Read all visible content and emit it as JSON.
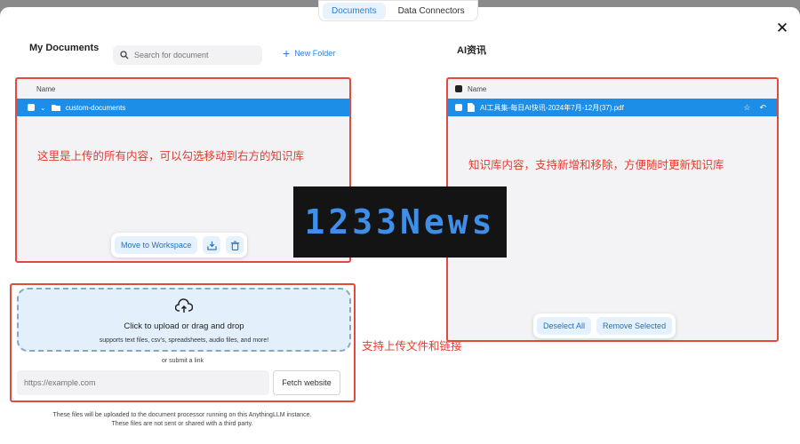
{
  "tabs": [
    {
      "label": "Documents",
      "active": true
    },
    {
      "label": "Data Connectors",
      "active": false
    }
  ],
  "left": {
    "title": "My Documents",
    "search_placeholder": "Search for document",
    "new_folder_label": "New Folder",
    "column_header": "Name",
    "folder_name": "custom-documents",
    "annotation": "这里是上传的所有内容，可以勾选移动到右方的知识库",
    "move_button": "Move to Workspace"
  },
  "right": {
    "title": "AI资讯",
    "column_header": "Name",
    "file_name": "AI工具集-每日AI快讯-2024年7月-12月(37).pdf",
    "annotation": "知识库内容，支持新增和移除，方便随时更新知识库",
    "deselect_label": "Deselect All",
    "remove_label": "Remove Selected"
  },
  "upload": {
    "title": "Click to upload or drag and drop",
    "subtitle": "supports text files, csv's, spreadsheets, audio files, and more!",
    "or_link": "or submit a link",
    "url_placeholder": "https://example.com",
    "fetch_label": "Fetch website",
    "annotation": "支持上传文件和链接"
  },
  "disclaimer_line1": "These files will be uploaded to the document processor running on this AnythingLLM instance.",
  "disclaimer_line2": "These files are not sent or shared with a third party.",
  "watermark": "1233News",
  "colors": {
    "accent": "#1d8ee8",
    "annotation": "#e23c2e",
    "highlight_border": "#e24a3c"
  }
}
